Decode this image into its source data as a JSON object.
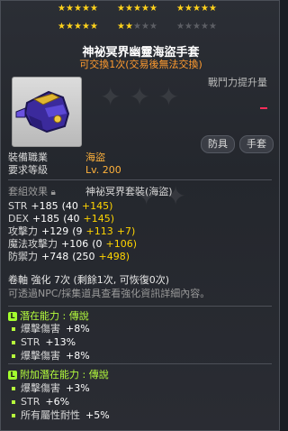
{
  "stars": {
    "rows": [
      {
        "groups": [
          [
            1,
            1,
            1,
            1,
            1
          ],
          [
            1,
            1,
            1,
            1,
            1
          ],
          [
            1,
            1,
            1,
            1,
            1
          ]
        ]
      },
      {
        "groups": [
          [
            1,
            1,
            1,
            1,
            1
          ],
          [
            1,
            1,
            0,
            0,
            0
          ],
          [
            0,
            0,
            0,
            0,
            0
          ]
        ]
      }
    ]
  },
  "item": {
    "name": "神祕冥界幽靈海盜手套",
    "tradeable": "可交換1次(交易後無法交換)",
    "power_label": "戰鬥力提升量",
    "tags": [
      "防具",
      "手套"
    ],
    "icon": "glove-item-icon"
  },
  "requirements": {
    "job_label": "裝備職業",
    "job_value": "海盜",
    "level_label": "要求等級",
    "level_value": "Lv. 200"
  },
  "set": {
    "label": "套組效果",
    "name": "神祕冥界套裝(海盜)"
  },
  "stats": [
    {
      "label": "STR",
      "value": "+185",
      "base": "(40",
      "bonus": "+145)",
      "extra": ""
    },
    {
      "label": "DEX",
      "value": "+185",
      "base": "(40",
      "bonus": "+145)",
      "extra": ""
    },
    {
      "label": "攻擊力",
      "value": "+129",
      "base": "(9",
      "bonus": "+113",
      "extra": "+7)"
    },
    {
      "label": "魔法攻擊力",
      "value": "+106",
      "base": "(0",
      "bonus": "+106)",
      "extra": ""
    },
    {
      "label": "防禦力",
      "value": "+748",
      "base": "(250",
      "bonus": "+498)",
      "extra": ""
    }
  ],
  "scroll": {
    "text": "卷軸 強化 7次 (剩餘1次, 可恢復0次)",
    "note": "可透過NPC/採集道具查看強化資訊詳細內容。"
  },
  "potential": {
    "header": "潛在能力 : 傳說",
    "badge": "L",
    "lines": [
      {
        "name": "爆擊傷害",
        "value": "+8%"
      },
      {
        "name": "STR",
        "value": "+13%"
      },
      {
        "name": "爆擊傷害",
        "value": "+8%"
      }
    ]
  },
  "additional": {
    "header": "附加潛在能力 : 傳說",
    "badge": "L",
    "lines": [
      {
        "name": "爆擊傷害",
        "value": "+3%"
      },
      {
        "name": "STR",
        "value": "+6%"
      },
      {
        "name": "所有屬性耐性",
        "value": "+5%"
      }
    ]
  },
  "colors": {
    "orange": "#ffb23c",
    "yellow": "#ffd400",
    "green": "#b6ff3c",
    "tradeable": "#ff9b2f"
  }
}
